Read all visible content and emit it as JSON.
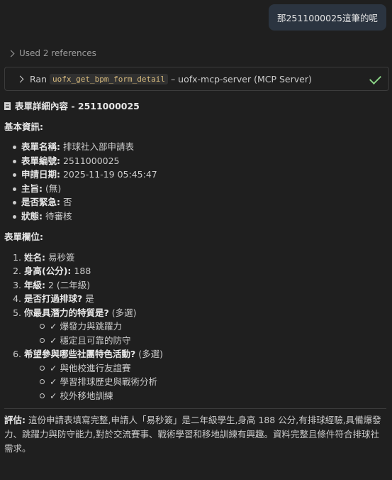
{
  "user_message": "那2511000025這筆的呢",
  "references": {
    "label": "Used 2 references"
  },
  "tool_call": {
    "prefix": "Ran",
    "tool_name": "uofx_get_bpm_form_detail",
    "server": "– uofx-mcp-server (MCP Server)",
    "status": "success"
  },
  "response": {
    "title": "表單詳細內容 - 2511000025",
    "basic_heading": "基本資訊:",
    "basic_items": [
      {
        "label": "表單名稱:",
        "value": "排球社入部申請表"
      },
      {
        "label": "表單編號:",
        "value": "2511000025"
      },
      {
        "label": "申請日期:",
        "value": "2025-11-19 05:45:47"
      },
      {
        "label": "主旨:",
        "value": "(無)"
      },
      {
        "label": "是否緊急:",
        "value": "否"
      },
      {
        "label": "狀態:",
        "value": "待審核"
      }
    ],
    "fields_heading": "表單欄位:",
    "fields": [
      {
        "label": "姓名:",
        "value": "易秒簽"
      },
      {
        "label": "身高(公分):",
        "value": "188"
      },
      {
        "label": "年級:",
        "value": "2 (二年級)"
      },
      {
        "label": "是否打過排球?",
        "value": "是"
      },
      {
        "label": "你最具潛力的特質是?",
        "value": "(多選)",
        "sub": [
          "✓ 爆發力與跳躍力",
          "✓ 穩定且可靠的防守"
        ]
      },
      {
        "label": "希望參與哪些社團特色活動?",
        "value": "(多選)",
        "sub": [
          "✓ 與他校進行友誼賽",
          "✓ 學習排球歷史與戰術分析",
          "✓ 校外移地訓練"
        ]
      }
    ],
    "evaluation_label": "評估:",
    "evaluation_text": "這份申請表填寫完整,申請人「易秒簽」是二年級學生,身高 188 公分,有排球經驗,具備爆發力、跳躍力與防守能力,對於交流賽事、戰術學習和移地訓練有興趣。資料完整且條件符合排球社需求。"
  }
}
